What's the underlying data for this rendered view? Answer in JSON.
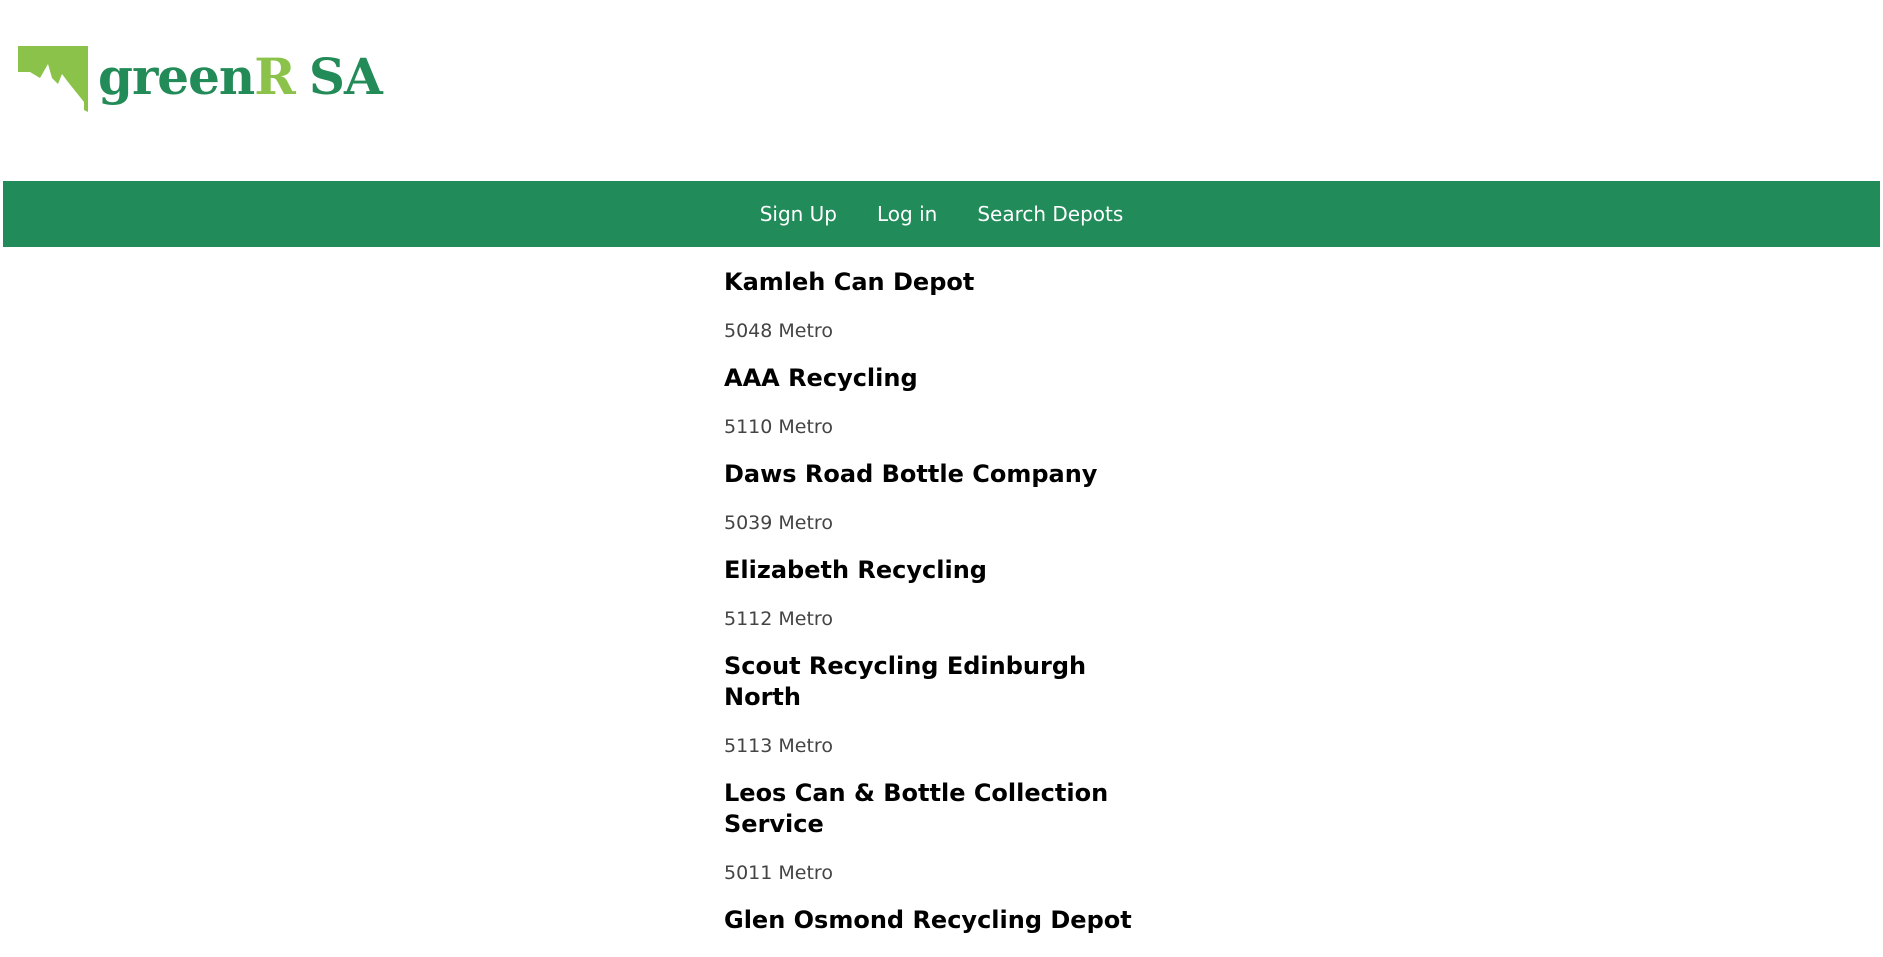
{
  "brand": {
    "name_main": "green",
    "name_accent": "R",
    "name_suffix": "SA",
    "primary_color": "#228b58",
    "accent_color": "#8bc34a",
    "icon": "south-australia-map-icon"
  },
  "nav": {
    "background_color": "#218b5a",
    "items": [
      {
        "label": "Sign Up"
      },
      {
        "label": "Log in"
      },
      {
        "label": "Search Depots"
      }
    ]
  },
  "depots": [
    {
      "name": "Kamleh Can Depot",
      "meta": "5048 Metro"
    },
    {
      "name": "AAA Recycling",
      "meta": "5110 Metro"
    },
    {
      "name": "Daws Road Bottle Company",
      "meta": "5039 Metro"
    },
    {
      "name": "Elizabeth Recycling",
      "meta": "5112 Metro"
    },
    {
      "name": "Scout Recycling Edinburgh North",
      "meta": "5113 Metro"
    },
    {
      "name": "Leos Can & Bottle Collection Service",
      "meta": "5011 Metro"
    },
    {
      "name": "Glen Osmond Recycling Depot",
      "meta": ""
    }
  ]
}
